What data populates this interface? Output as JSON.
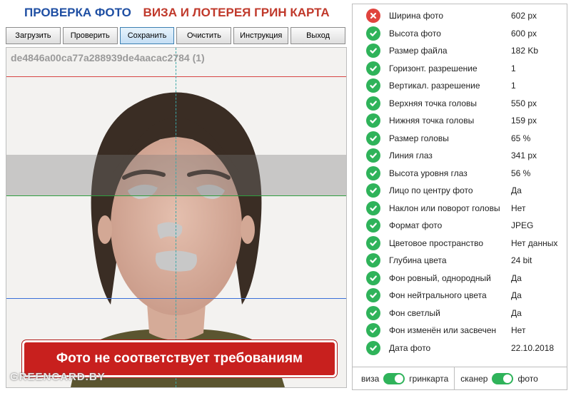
{
  "header": {
    "title_part1": "ПРОВЕРКА ФОТО",
    "title_part2": "ВИЗА И ЛОТЕРЕЯ ГРИН КАРТА"
  },
  "toolbar": {
    "buttons": [
      {
        "label": "Загрузить"
      },
      {
        "label": "Проверить"
      },
      {
        "label": "Сохранить",
        "active": true
      },
      {
        "label": "Очистить"
      },
      {
        "label": "Инструкция"
      },
      {
        "label": "Выход"
      }
    ]
  },
  "photo": {
    "filename": "de4846a00ca77a288939de4aacac2784 (1)",
    "warning": "Фото не соответствует требованиям",
    "watermark": "GREENCARD.BY"
  },
  "checks": [
    {
      "label": "Ширина фото",
      "value": "602 px",
      "status": "fail"
    },
    {
      "label": "Высота фото",
      "value": "600 px",
      "status": "ok"
    },
    {
      "label": "Размер файла",
      "value": "182 Kb",
      "status": "ok"
    },
    {
      "label": "Горизонт. разрешение",
      "value": "1",
      "status": "ok"
    },
    {
      "label": "Вертикал. разрешение",
      "value": "1",
      "status": "ok"
    },
    {
      "label": "Верхняя точка головы",
      "value": "550 px",
      "status": "ok"
    },
    {
      "label": "Нижняя точка головы",
      "value": "159 px",
      "status": "ok"
    },
    {
      "label": "Размер головы",
      "value": "65 %",
      "status": "ok"
    },
    {
      "label": "Линия глаз",
      "value": "341 px",
      "status": "ok"
    },
    {
      "label": "Высота уровня глаз",
      "value": "56 %",
      "status": "ok"
    },
    {
      "label": "Лицо по центру фото",
      "value": "Да",
      "status": "ok"
    },
    {
      "label": "Наклон или поворот головы",
      "value": "Нет",
      "status": "ok"
    },
    {
      "label": "Формат фото",
      "value": "JPEG",
      "status": "ok"
    },
    {
      "label": "Цветовое пространство",
      "value": "Нет данных",
      "status": "ok"
    },
    {
      "label": "Глубина цвета",
      "value": "24 bit",
      "status": "ok"
    },
    {
      "label": "Фон ровный, однородный",
      "value": "Да",
      "status": "ok"
    },
    {
      "label": "Фон нейтрального цвета",
      "value": "Да",
      "status": "ok"
    },
    {
      "label": "Фон светлый",
      "value": "Да",
      "status": "ok"
    },
    {
      "label": "Фон изменён или засвечен",
      "value": "Нет",
      "status": "ok"
    },
    {
      "label": "Дата фото",
      "value": "22.10.2018",
      "status": "ok"
    }
  ],
  "footer": {
    "toggle1": {
      "left": "виза",
      "right": "гринкарта",
      "state": "right"
    },
    "toggle2": {
      "left": "сканер",
      "right": "фото",
      "state": "right"
    }
  },
  "colors": {
    "ok": "#2fb35a",
    "fail": "#e0443e",
    "top_line": "#d64545",
    "eye_line": "#2e9e3e",
    "chin_line": "#3a6fd8",
    "center_line": "#3aa8a8"
  }
}
